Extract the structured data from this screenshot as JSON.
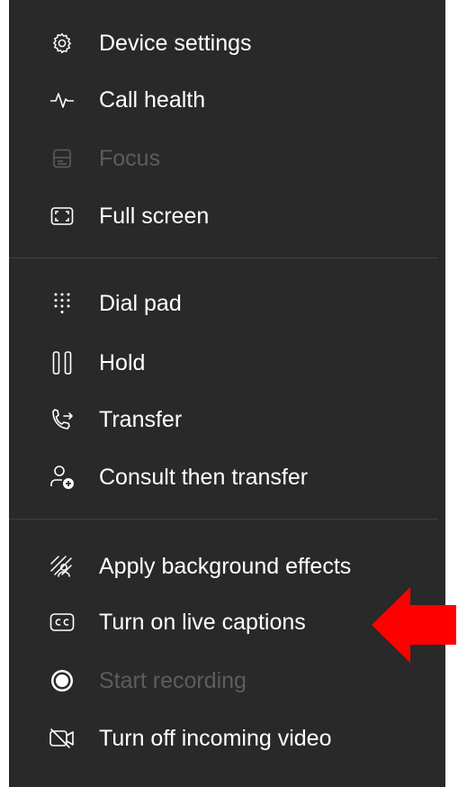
{
  "menu": {
    "items": [
      {
        "label": "Device settings",
        "icon": "gear-icon"
      },
      {
        "label": "Call health",
        "icon": "pulse-icon"
      },
      {
        "label": "Focus",
        "icon": "focus-icon",
        "disabled": true
      },
      {
        "label": "Full screen",
        "icon": "fullscreen-icon"
      },
      {
        "label": "Dial pad",
        "icon": "dialpad-icon"
      },
      {
        "label": "Hold",
        "icon": "pause-icon"
      },
      {
        "label": "Transfer",
        "icon": "phone-transfer-icon"
      },
      {
        "label": "Consult then transfer",
        "icon": "person-add-icon"
      },
      {
        "label": "Apply background effects",
        "icon": "background-effects-icon"
      },
      {
        "label": "Turn on live captions",
        "icon": "closed-captions-icon"
      },
      {
        "label": "Start recording",
        "icon": "record-icon",
        "disabled": true
      },
      {
        "label": "Turn off incoming video",
        "icon": "video-off-icon"
      }
    ]
  },
  "colors": {
    "panel_bg": "#292929",
    "text": "#ffffff",
    "disabled_text": "#5d5d5d",
    "divider": "#3f3f3f",
    "annotation_arrow": "#ff0000"
  }
}
